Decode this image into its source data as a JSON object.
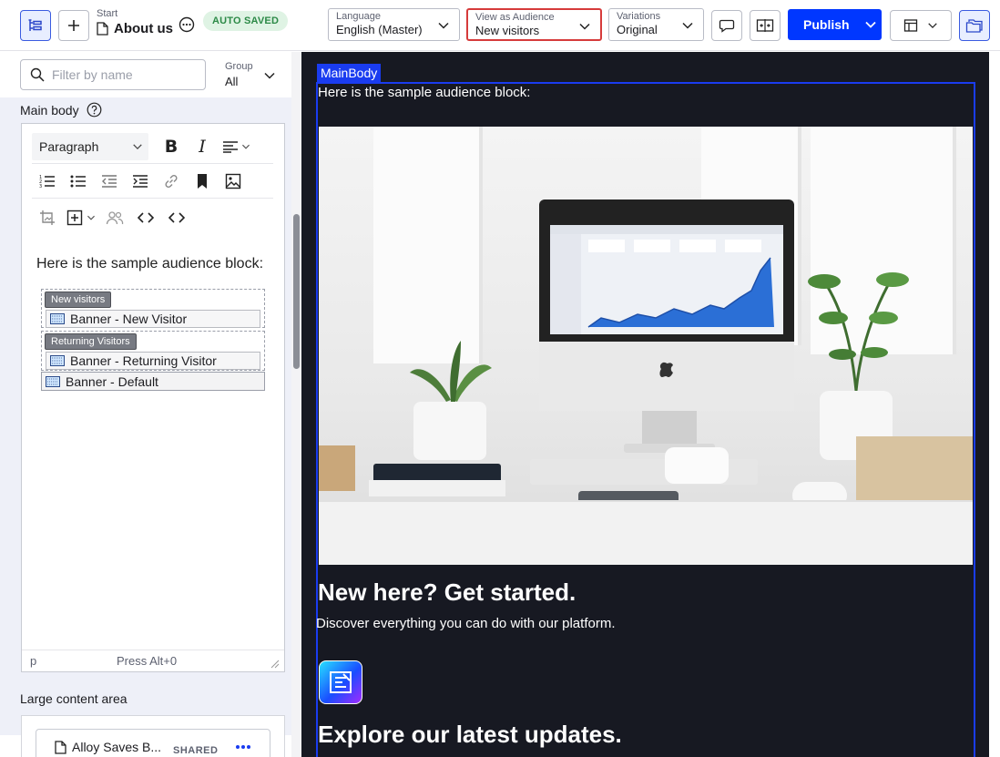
{
  "topbar": {
    "breadcrumb_parent": "Start",
    "page_title": "About us",
    "autosave_badge": "AUTO SAVED",
    "language": {
      "label": "Language",
      "value": "English (Master)"
    },
    "audience": {
      "label": "View as Audience",
      "value": "New visitors"
    },
    "variations": {
      "label": "Variations",
      "value": "Original"
    },
    "publish_label": "Publish"
  },
  "sidebar": {
    "filter_placeholder": "Filter by name",
    "group_label": "Group",
    "group_value": "All",
    "main_body_label": "Main body",
    "editor": {
      "paragraph_format": "Paragraph",
      "content_intro": "Here is the sample audience block:",
      "audience_new_tag": "New visitors",
      "audience_new_block": "Banner - New Visitor",
      "audience_returning_tag": "Returning Visitors",
      "audience_returning_block": "Banner - Returning Visitor",
      "default_block": "Banner - Default",
      "status_path": "p",
      "status_hint": "Press Alt+0"
    },
    "large_content_area_label": "Large content area",
    "lca_item_name": "Alloy Saves B...",
    "lca_item_badge": "SHARED"
  },
  "preview": {
    "area_tag": "MainBody",
    "intro_text": "Here is the sample audience block:",
    "heading1": "New here? Get started.",
    "subtext": "Discover everything you can do with our platform.",
    "heading2": "Explore our latest updates."
  },
  "colors": {
    "accent": "#0037ff",
    "highlight_border": "#d63b3b",
    "saved_badge_bg": "#dff3e4",
    "saved_badge_text": "#2c8a47",
    "preview_bg": "#171922"
  }
}
